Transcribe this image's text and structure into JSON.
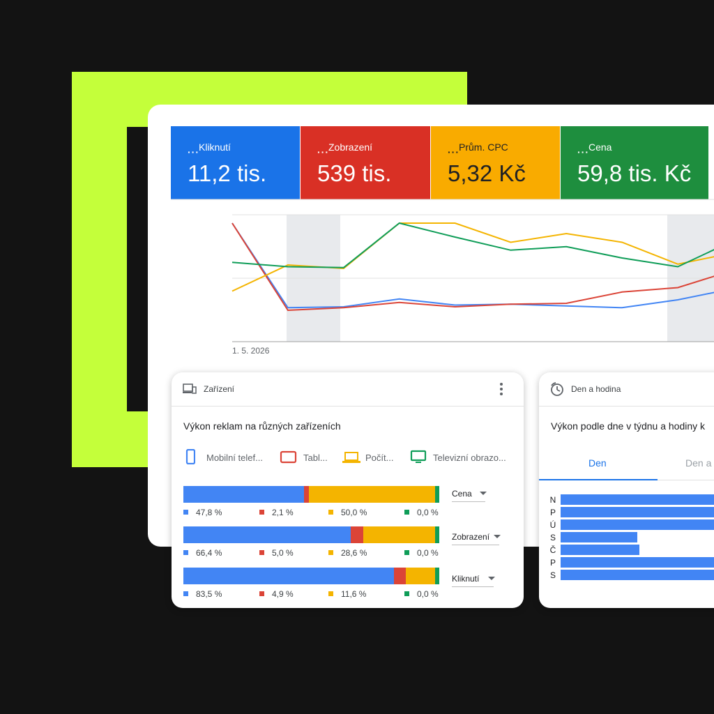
{
  "kpis": [
    {
      "label": "Kliknutí",
      "value": "11,2 tis.",
      "color": "#1a73e8"
    },
    {
      "label": "Zobrazení",
      "value": "539 tis.",
      "color": "#d93025"
    },
    {
      "label": "Prům. CPC",
      "value": "5,32 Kč",
      "color": "#f9ab00"
    },
    {
      "label": "Cena",
      "value": "59,8 tis. Kč",
      "color": "#1e8e3e"
    }
  ],
  "chart_data": {
    "type": "line",
    "x_start_label": "1. 5. 2026",
    "points": 10,
    "series": [
      {
        "color": "#4285f4",
        "values": [
          100,
          3,
          4,
          13,
          6,
          7,
          5,
          3,
          12,
          25
        ]
      },
      {
        "color": "#db4437",
        "values": [
          100,
          0,
          3,
          9,
          4,
          7,
          8,
          21,
          26,
          46
        ]
      },
      {
        "color": "#f4b400",
        "values": [
          22,
          52,
          48,
          100,
          100,
          78,
          88,
          78,
          53,
          66
        ]
      },
      {
        "color": "#0f9d58",
        "values": [
          55,
          50,
          49,
          100,
          84,
          69,
          73,
          60,
          50,
          80
        ]
      }
    ]
  },
  "devices_panel": {
    "header": "Zařízení",
    "title": "Výkon reklam na různých zařízeních",
    "legend": [
      {
        "label": "Mobilní telef...",
        "color": "#4285f4",
        "icon": "phone-icon"
      },
      {
        "label": "Tabl...",
        "color": "#db4437",
        "icon": "tablet-icon"
      },
      {
        "label": "Počít...",
        "color": "#f4b400",
        "icon": "laptop-icon"
      },
      {
        "label": "Televizní obrazo...",
        "color": "#0f9d58",
        "icon": "tv-icon"
      }
    ],
    "rows": [
      {
        "metric": "Cena",
        "values": [
          47.8,
          2.1,
          50.0,
          0.0
        ],
        "labels": [
          "47,8 %",
          "2,1 %",
          "50,0 %",
          "0,0 %"
        ]
      },
      {
        "metric": "Zobrazení",
        "values": [
          66.4,
          5.0,
          28.6,
          0.0
        ],
        "labels": [
          "66,4 %",
          "5,0 %",
          "28,6 %",
          "0,0 %"
        ]
      },
      {
        "metric": "Kliknutí",
        "values": [
          83.5,
          4.9,
          11.6,
          0.0
        ],
        "labels": [
          "83,5 %",
          "4,9 %",
          "11,6 %",
          "0,0 %"
        ]
      }
    ]
  },
  "day_panel": {
    "header": "Den a hodina",
    "title": "Výkon podle dne v týdnu a hodiny k",
    "tabs": [
      "Den",
      "Den a"
    ],
    "days": [
      {
        "label": "N",
        "value": 100
      },
      {
        "label": "P",
        "value": 100
      },
      {
        "label": "Ú",
        "value": 100
      },
      {
        "label": "S",
        "value": 45
      },
      {
        "label": "Č",
        "value": 46
      },
      {
        "label": "P",
        "value": 100
      },
      {
        "label": "S",
        "value": 100
      }
    ]
  }
}
